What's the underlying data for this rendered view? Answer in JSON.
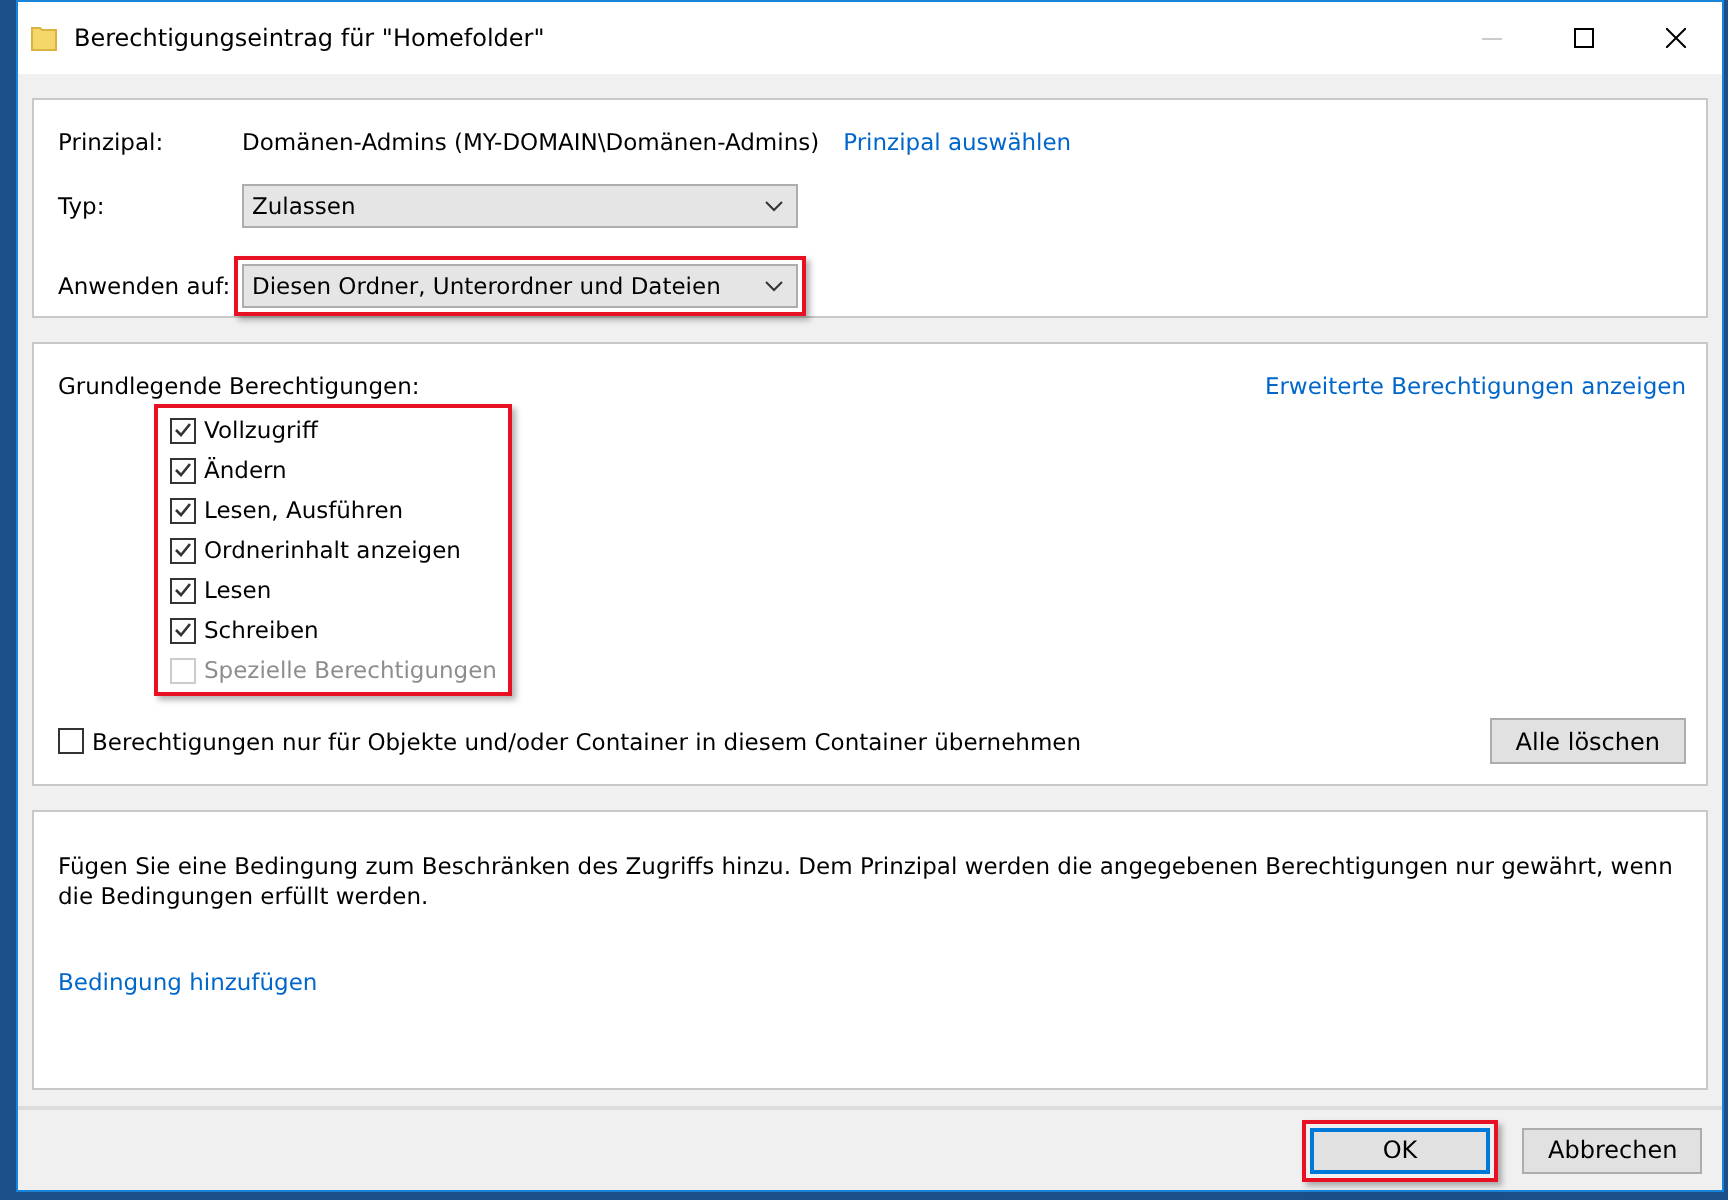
{
  "window": {
    "title": "Berechtigungseintrag für \"Homefolder\""
  },
  "principal": {
    "label": "Prinzipal:",
    "value": "Domänen-Admins (MY-DOMAIN\\Domänen-Admins)",
    "link": "Prinzipal auswählen"
  },
  "type": {
    "label": "Typ:",
    "value": "Zulassen",
    "highlighted": false
  },
  "apply_to": {
    "label": "Anwenden auf:",
    "value": "Diesen Ordner, Unterordner und Dateien",
    "highlighted": true
  },
  "permissions": {
    "label": "Grundlegende Berechtigungen:",
    "link": "Erweiterte Berechtigungen anzeigen",
    "highlighted": true,
    "items": [
      {
        "label": "Vollzugriff",
        "checked": true,
        "disabled": false
      },
      {
        "label": "Ändern",
        "checked": true,
        "disabled": false
      },
      {
        "label": "Lesen, Ausführen",
        "checked": true,
        "disabled": false
      },
      {
        "label": "Ordnerinhalt anzeigen",
        "checked": true,
        "disabled": false
      },
      {
        "label": "Lesen",
        "checked": true,
        "disabled": false
      },
      {
        "label": "Schreiben",
        "checked": true,
        "disabled": false
      },
      {
        "label": "Spezielle Berechtigungen",
        "checked": false,
        "disabled": true
      }
    ]
  },
  "inherit": {
    "label": "Berechtigungen nur für Objekte und/oder Container in diesem Container übernehmen",
    "checked": false
  },
  "clear_button": "Alle löschen",
  "condition": {
    "text": "Fügen Sie eine Bedingung zum Beschränken des Zugriffs hinzu. Dem Prinzipal werden die angegebenen Berechtigungen nur gewährt, wenn die Bedingungen erfüllt werden.",
    "link": "Bedingung hinzufügen"
  },
  "buttons": [
    {
      "label": "OK",
      "highlighted": true
    },
    {
      "label": "Abbrechen",
      "highlighted": false
    }
  ]
}
